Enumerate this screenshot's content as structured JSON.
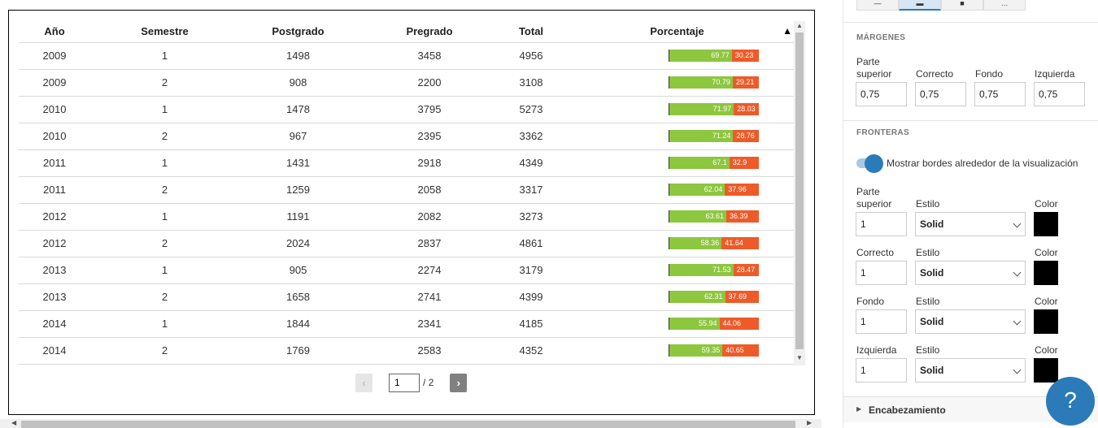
{
  "table": {
    "headers": [
      "Año",
      "Semestre",
      "Postgrado",
      "Pregrado",
      "Total",
      "Porcentaje"
    ],
    "sort_indicator": "▲",
    "rows": [
      {
        "year": "2009",
        "semester": "1",
        "postgrado": "1498",
        "pregrado": "3458",
        "total": "4956",
        "pct_a": "69.77",
        "pct_b": "30.23"
      },
      {
        "year": "2009",
        "semester": "2",
        "postgrado": "908",
        "pregrado": "2200",
        "total": "3108",
        "pct_a": "70.79",
        "pct_b": "29.21"
      },
      {
        "year": "2010",
        "semester": "1",
        "postgrado": "1478",
        "pregrado": "3795",
        "total": "5273",
        "pct_a": "71.97",
        "pct_b": "28.03"
      },
      {
        "year": "2010",
        "semester": "2",
        "postgrado": "967",
        "pregrado": "2395",
        "total": "3362",
        "pct_a": "71.24",
        "pct_b": "28.76"
      },
      {
        "year": "2011",
        "semester": "1",
        "postgrado": "1431",
        "pregrado": "2918",
        "total": "4349",
        "pct_a": "67.1",
        "pct_b": "32.9"
      },
      {
        "year": "2011",
        "semester": "2",
        "postgrado": "1259",
        "pregrado": "2058",
        "total": "3317",
        "pct_a": "62.04",
        "pct_b": "37.96"
      },
      {
        "year": "2012",
        "semester": "1",
        "postgrado": "1191",
        "pregrado": "2082",
        "total": "3273",
        "pct_a": "63.61",
        "pct_b": "36.39"
      },
      {
        "year": "2012",
        "semester": "2",
        "postgrado": "2024",
        "pregrado": "2837",
        "total": "4861",
        "pct_a": "58.36",
        "pct_b": "41.64"
      },
      {
        "year": "2013",
        "semester": "1",
        "postgrado": "905",
        "pregrado": "2274",
        "total": "3179",
        "pct_a": "71.53",
        "pct_b": "28.47"
      },
      {
        "year": "2013",
        "semester": "2",
        "postgrado": "1658",
        "pregrado": "2741",
        "total": "4399",
        "pct_a": "62.31",
        "pct_b": "37.69"
      },
      {
        "year": "2014",
        "semester": "1",
        "postgrado": "1844",
        "pregrado": "2341",
        "total": "4185",
        "pct_a": "55.94",
        "pct_b": "44.06"
      },
      {
        "year": "2014",
        "semester": "2",
        "postgrado": "1769",
        "pregrado": "2583",
        "total": "4352",
        "pct_a": "59.35",
        "pct_b": "40.65"
      }
    ],
    "colors": {
      "pct_a": "#8dc63f",
      "pct_b": "#ee5a28"
    }
  },
  "pager": {
    "prev": "‹",
    "next": "›",
    "current_page": "1",
    "total_pages": "/ 2"
  },
  "panel": {
    "margins": {
      "title": "MÁRGENES",
      "labels": [
        "Parte superior",
        "Correcto",
        "Fondo",
        "Izquierda"
      ],
      "values": [
        "0,75",
        "0,75",
        "0,75",
        "0,75"
      ]
    },
    "borders": {
      "title": "FRONTERAS",
      "toggle_label": "Mostrar bordes alrededor de la visualización",
      "toggle_on": true,
      "style_label": "Estilo",
      "color_label": "Color",
      "rows": [
        {
          "label": "Parte superior",
          "width": "1",
          "style": "Solid",
          "color": "#000000"
        },
        {
          "label": "Correcto",
          "width": "1",
          "style": "Solid",
          "color": "#000000"
        },
        {
          "label": "Fondo",
          "width": "1",
          "style": "Solid",
          "color": "#000000"
        },
        {
          "label": "Izquierda",
          "width": "1",
          "style": "Solid",
          "color": "#000000"
        }
      ]
    },
    "header_section": {
      "title": "Encabezamiento",
      "icon": "triangle-right-icon"
    },
    "help_label": "?",
    "accent": "#2b7bb9"
  }
}
